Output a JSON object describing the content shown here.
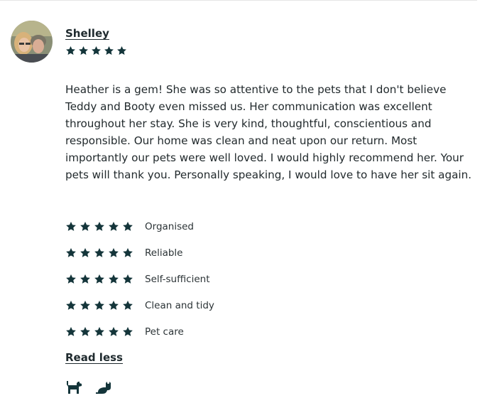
{
  "review": {
    "reviewer_name": "Shelley",
    "overall_rating": 5,
    "text": "Heather is a gem! She was so attentive to the pets that I don't believe Teddy and Booty even missed us. Her communication was excellent throughout her stay. She is very kind, thoughtful, conscientious and responsible. Our home was clean and neat upon our return. Most importantly our pets were well loved. I would highly recommend her. Your pets will thank you. Personally speaking, I would love to have her sit again.",
    "categories": [
      {
        "label": "Organised",
        "rating": 5
      },
      {
        "label": "Reliable",
        "rating": 5
      },
      {
        "label": "Self-sufficient",
        "rating": 5
      },
      {
        "label": "Clean and tidy",
        "rating": 5
      },
      {
        "label": "Pet care",
        "rating": 5
      }
    ],
    "toggle_label": "Read less",
    "pets": [
      "dog-icon",
      "cat-icon"
    ]
  },
  "colors": {
    "star": "#14353a",
    "text": "#222a2d"
  }
}
